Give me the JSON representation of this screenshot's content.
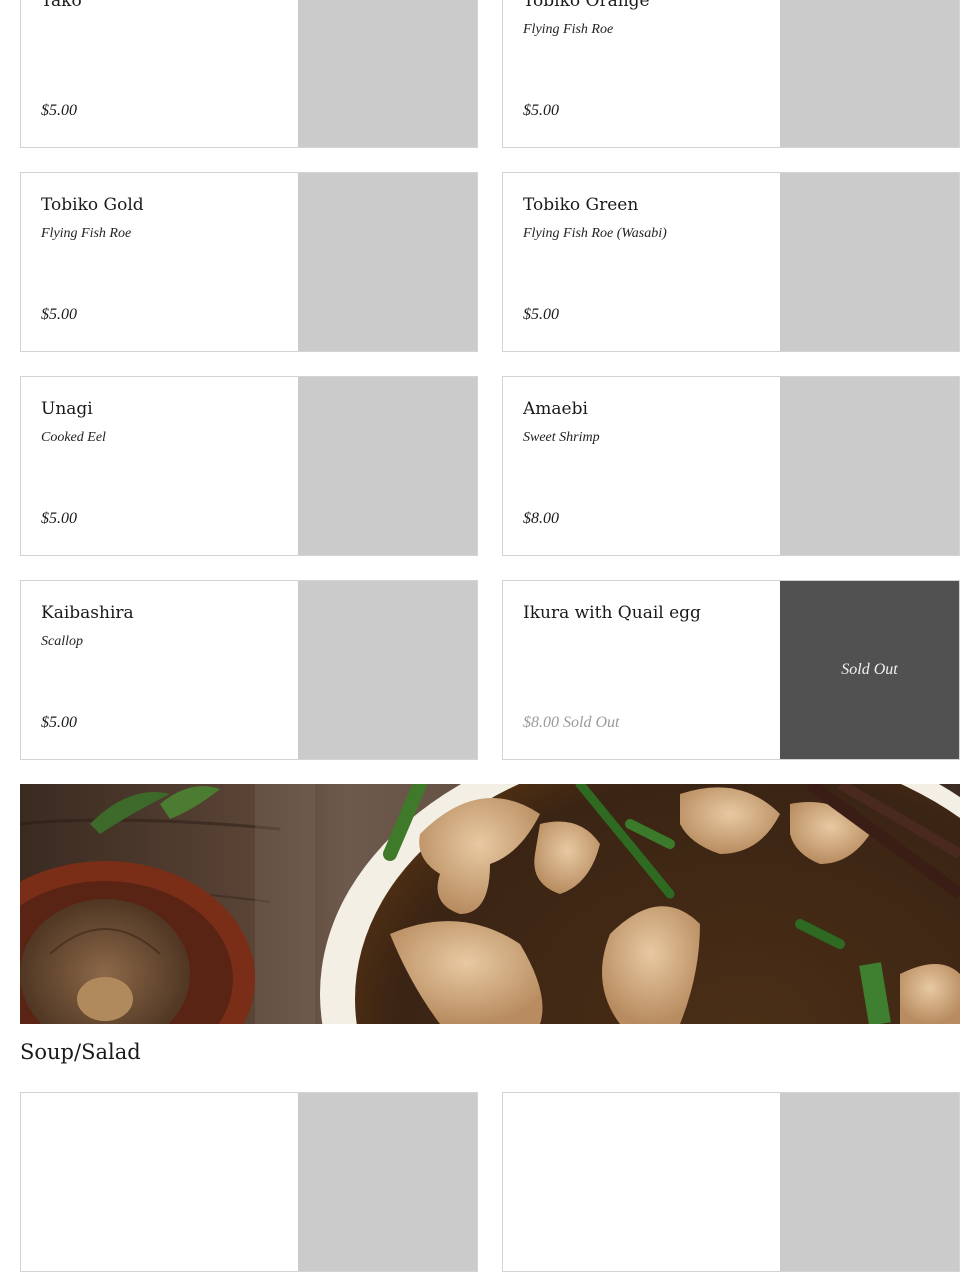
{
  "menu_items": [
    {
      "name": "Tako",
      "description": "",
      "price": "$5.00"
    },
    {
      "name": "Tobiko Orange",
      "description": "Flying Fish Roe",
      "price": "$5.00"
    },
    {
      "name": "Tobiko Gold",
      "description": "Flying Fish Roe",
      "price": "$5.00"
    },
    {
      "name": "Tobiko Green",
      "description": "Flying Fish Roe (Wasabi)",
      "price": "$5.00"
    },
    {
      "name": "Unagi",
      "description": "Cooked Eel",
      "price": "$5.00"
    },
    {
      "name": "Amaebi",
      "description": "Sweet Shrimp",
      "price": "$8.00"
    },
    {
      "name": "Kaibashira",
      "description": "Scallop",
      "price": "$5.00"
    },
    {
      "name": "Ikura with Quail egg",
      "description": "",
      "price": "$8.00 Sold Out",
      "overlay": "Sold Out"
    }
  ],
  "section": {
    "title": "Soup/Salad"
  },
  "colors": {
    "placeholder": "#cbcbcb",
    "soldout": "#515151",
    "border": "#d3d3d3"
  }
}
